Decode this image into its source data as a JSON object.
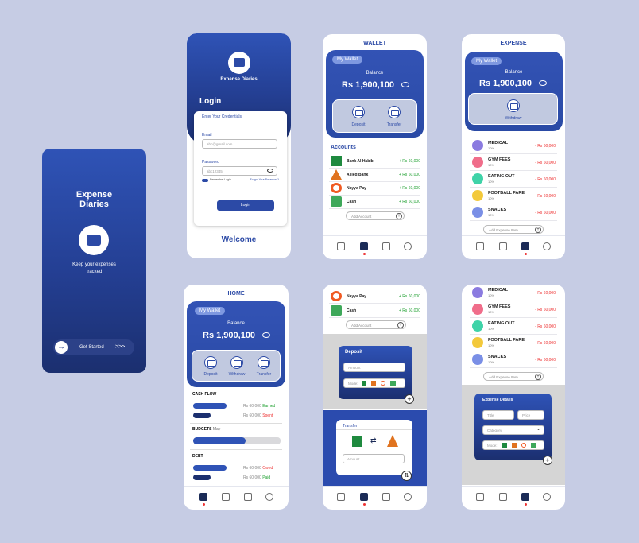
{
  "splash": {
    "title_line1": "Expense",
    "title_line2": "Diaries",
    "tagline_line1": "Keep your expenses",
    "tagline_line2": "tracked",
    "cta": "Get Started",
    "cta_arrows": ">>>"
  },
  "login": {
    "app_name": "Expense Diaries",
    "heading": "Login",
    "subheading": "Enter Your Credentials",
    "email_label": "Email",
    "email_placeholder": "abc@gmail.com",
    "password_label": "Password",
    "password_placeholder": "abc12345",
    "remember": "Remember Login",
    "forgot": "Forgot Your Password?",
    "button": "Login",
    "welcome": "Welcome"
  },
  "wallet": {
    "title": "WALLET",
    "tag": "My Wallet",
    "balance_label": "Balance",
    "balance": "Rs 1,900,100",
    "deposit": "Deposit",
    "transfer": "Transfer",
    "accounts_heading": "Accounts",
    "accounts": [
      {
        "name": "Bank Al Habib",
        "amount": "+ Rs 60,000"
      },
      {
        "name": "Allied Bank",
        "amount": "+ Rs 60,000"
      },
      {
        "name": "Nayya Pay",
        "amount": "+ Rs 60,000"
      },
      {
        "name": "Cash",
        "amount": "+ Rs 60,000"
      }
    ],
    "add_account": "Add Account"
  },
  "expense": {
    "title": "EXPENSE",
    "tag": "My Wallet",
    "balance_label": "Balance",
    "balance": "Rs 1,900,100",
    "withdraw": "Withdraw",
    "items": [
      {
        "name": "MEDICAL",
        "pct": "10%",
        "amount": "- Rs 60,000",
        "color": "#8b7be0"
      },
      {
        "name": "GYM FEES",
        "pct": "10%",
        "amount": "- Rs 60,000",
        "color": "#f06d8a"
      },
      {
        "name": "EATING OUT",
        "pct": "10%",
        "amount": "- Rs 60,000",
        "color": "#3fd3a8"
      },
      {
        "name": "FOOTBALL FARE",
        "pct": "10%",
        "amount": "- Rs 60,000",
        "color": "#f3c93b"
      },
      {
        "name": "SNACKS",
        "pct": "10%",
        "amount": "- Rs 60,000",
        "color": "#7a8fe6"
      }
    ],
    "add_item": "Add Expense Item"
  },
  "home": {
    "title": "HOME",
    "tag": "My Wallet",
    "balance_label": "Balance",
    "balance": "Rs 1,900,100",
    "deposit": "Deposit",
    "withdraw": "Withdraw",
    "transfer": "Transfer",
    "cashflow": "CASH FLOW",
    "earned_amt": "Rs 60,000",
    "earned": "Earned",
    "spent_amt": "Rs 60,000",
    "spent": "Spent",
    "budgets": "BUDGETS",
    "budgets_month": "May",
    "budget_progress": 0.6,
    "debt": "DEBT",
    "owed_amt": "Rs 60,000",
    "owed": "Owed",
    "paid_amt": "Rs 60,000",
    "paid": "Paid"
  },
  "deposit_screen": {
    "accounts": [
      {
        "name": "Nayya Pay",
        "amount": "+ Rs 60,000"
      },
      {
        "name": "Cash",
        "amount": "+ Rs 60,000"
      }
    ],
    "add_account": "Add Account",
    "deposit_title": "Deposit",
    "amount_placeholder": "Amount",
    "mode_label": "Mode:",
    "transfer_title": "Transfer"
  },
  "expense_details": {
    "items": [
      {
        "name": "MEDICAL",
        "pct": "10%",
        "amount": "- Rs 60,000",
        "color": "#8b7be0"
      },
      {
        "name": "GYM FEES",
        "pct": "10%",
        "amount": "- Rs 60,000",
        "color": "#f06d8a"
      },
      {
        "name": "EATING OUT",
        "pct": "10%",
        "amount": "- Rs 60,000",
        "color": "#3fd3a8"
      },
      {
        "name": "FOOTBALL FARE",
        "pct": "10%",
        "amount": "- Rs 60,000",
        "color": "#f3c93b"
      },
      {
        "name": "SNACKS",
        "pct": "10%",
        "amount": "- Rs 60,000",
        "color": "#7a8fe6"
      }
    ],
    "add_item": "Add Expense Item",
    "title": "Expense Details",
    "title_placeholder": "Title",
    "price_placeholder": "Price",
    "category_placeholder": "Category",
    "mode_label": "Mode:"
  },
  "colors": {
    "primary": "#2f53b6",
    "dark": "#1b2f6f",
    "positive": "#22a133",
    "negative": "#e33333"
  }
}
